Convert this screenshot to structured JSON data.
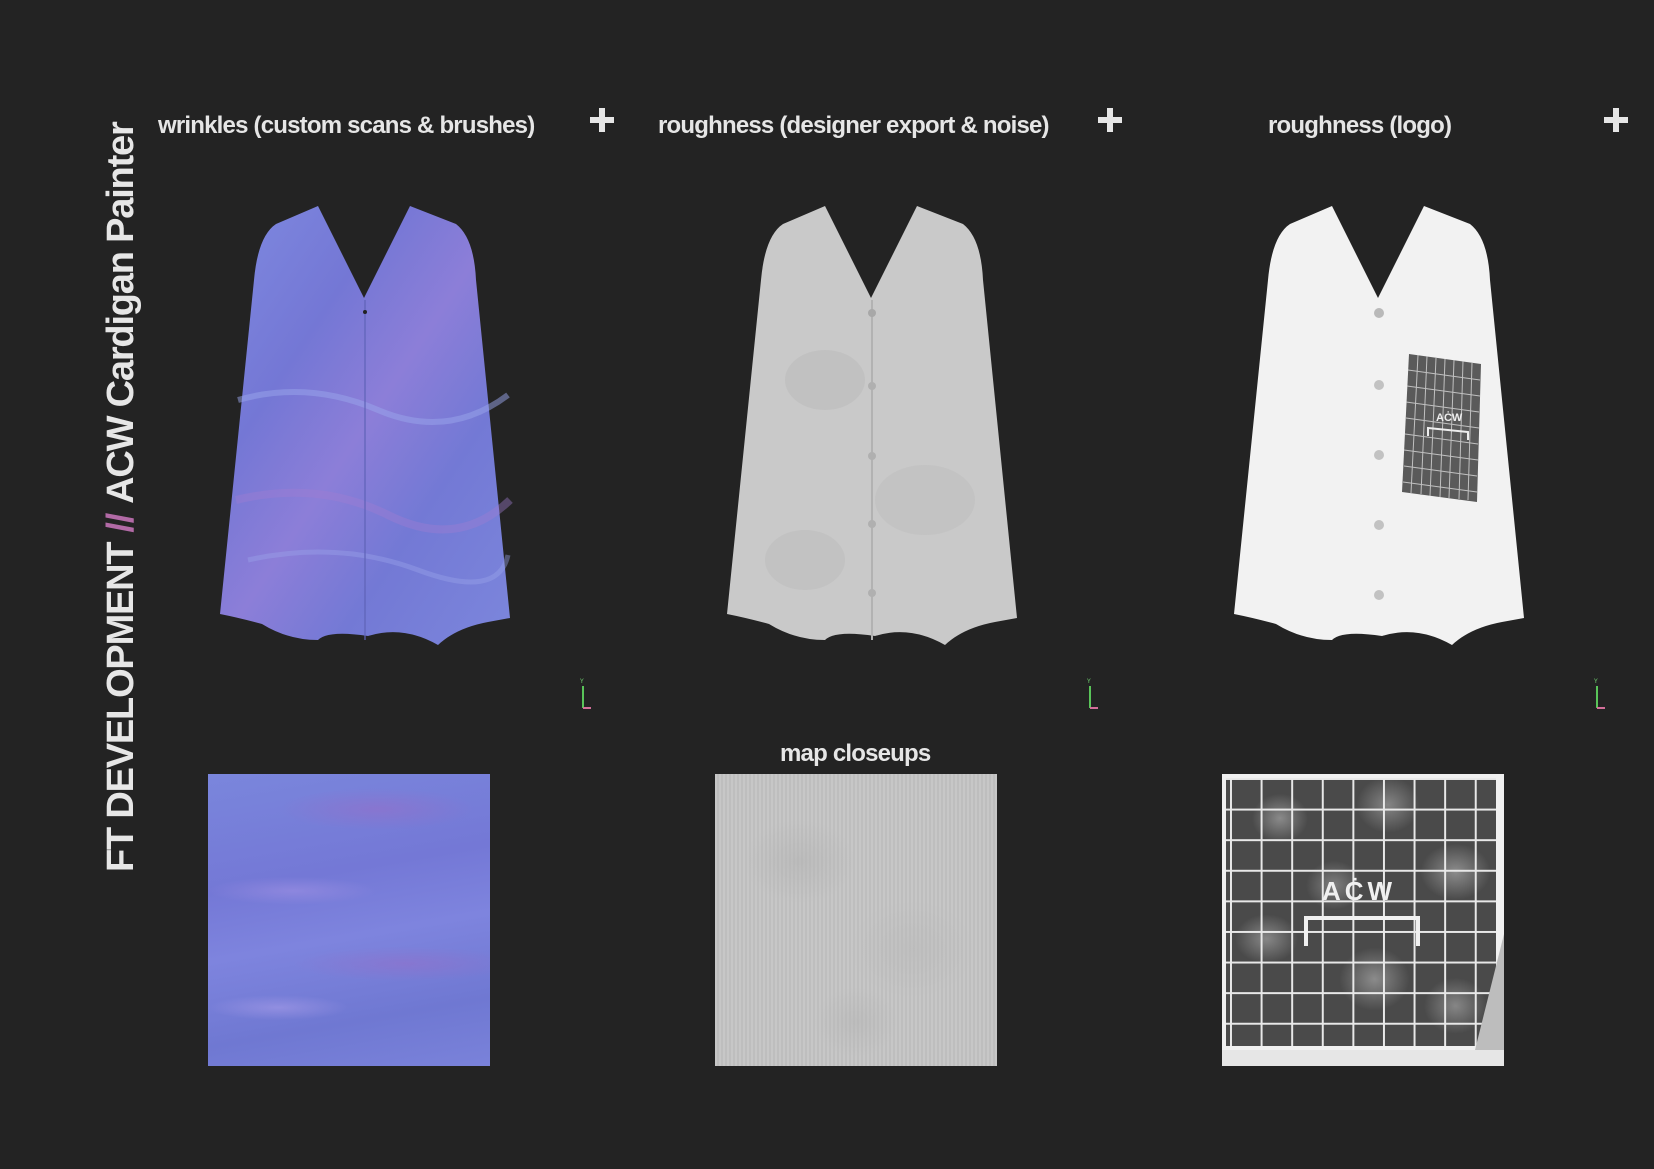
{
  "side_title": {
    "part1": "FT DEVELOPMENT",
    "separator": "//",
    "part2": "ACW Cardigan Painter"
  },
  "columns": [
    {
      "label": "wrinkles (custom scans & brushes)",
      "fill": "#7a84dc"
    },
    {
      "label": "roughness (designer export & noise)",
      "fill": "#c8c8c8"
    },
    {
      "label": "roughness (logo)",
      "fill": "#f2f2f2"
    }
  ],
  "axis_gizmo_label": "Y",
  "closeups_title": "map closeups",
  "logo_text": "AĊW",
  "colors": {
    "background": "#232323",
    "text": "#e6e6e6",
    "accent": "#b26aa6",
    "wrinkle_blue": "#7a84dc"
  }
}
